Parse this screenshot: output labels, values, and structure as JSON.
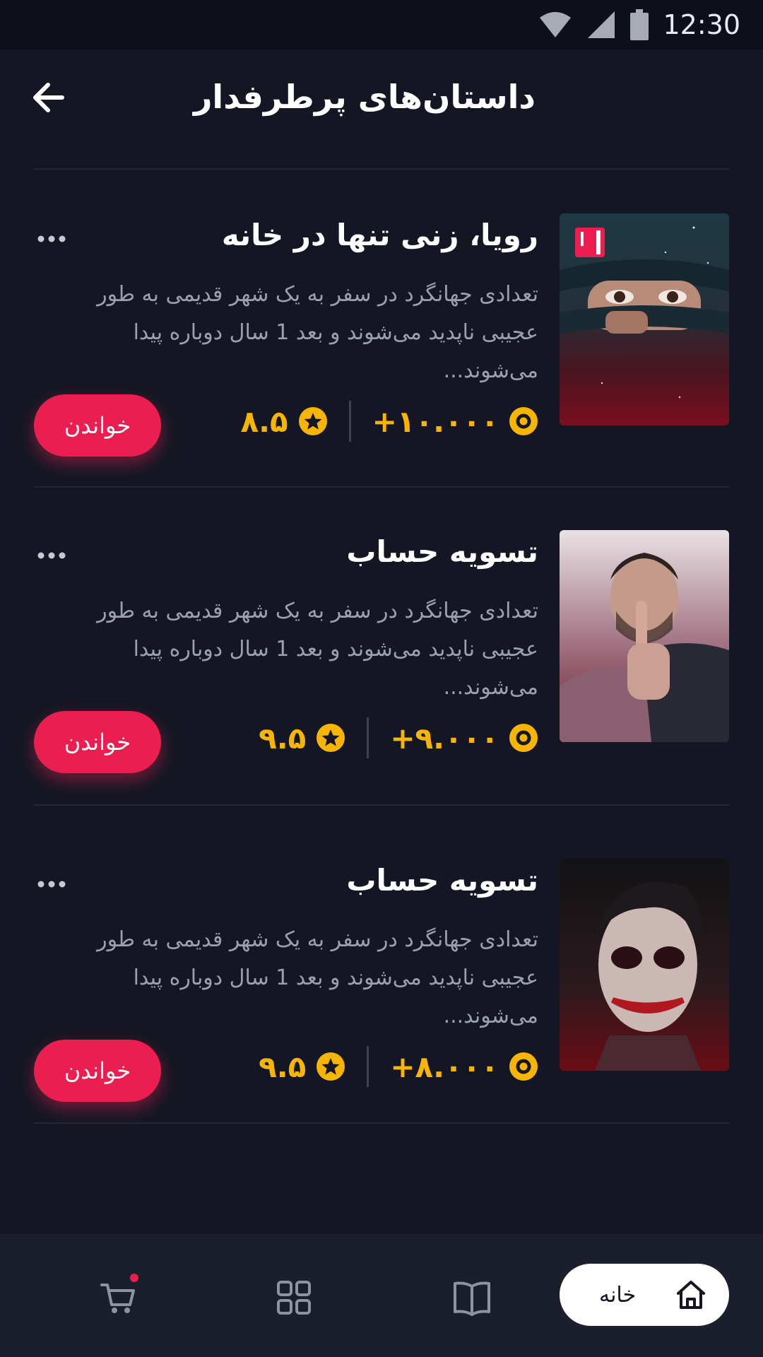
{
  "status_bar": {
    "time": "12:30",
    "icons": [
      "wifi-icon",
      "cellular-signal-icon",
      "battery-icon"
    ]
  },
  "header": {
    "title": "داستان‌های پرطرفدار",
    "back_icon": "arrow-left-icon"
  },
  "colors": {
    "background": "#141723",
    "accent": "#ea1e4f",
    "stat": "#f7b500",
    "description": "#9aa0ad",
    "nav_background": "#1b1f2c"
  },
  "stories": [
    {
      "title": "رویا، زنی تنها در خانه",
      "description": "تعدادی جهانگرد در سفر به یک شهر قدیمی به طور عجیبی ناپدید می‌شوند و بعد 1 سال دوباره پیدا می‌شوند...",
      "views": "+۱۰.۰۰۰",
      "rating": "۸.۵",
      "read_label": "خواندن",
      "cover": "woman-peeking-through-starry-fabric",
      "has_book_badge": true
    },
    {
      "title": "تسویه حساب",
      "description": "تعدادی جهانگرد در سفر به یک شهر قدیمی به طور عجیبی ناپدید می‌شوند و بعد 1 سال دوباره پیدا می‌شوند...",
      "views": "+۹.۰۰۰",
      "rating": "۹.۵",
      "read_label": "خواندن",
      "cover": "man-finger-on-lips"
    },
    {
      "title": "تسویه حساب",
      "description": "تعدادی جهانگرد در سفر به یک شهر قدیمی به طور عجیبی ناپدید می‌شوند و بعد 1 سال دوباره پیدا می‌شوند...",
      "views": "+۸.۰۰۰",
      "rating": "۹.۵",
      "read_label": "خواندن",
      "cover": "joker-face-makeup"
    }
  ],
  "bottom_nav": {
    "home_label": "خانه",
    "items": [
      "home-icon",
      "book-icon",
      "grid-icon",
      "cart-icon"
    ]
  }
}
